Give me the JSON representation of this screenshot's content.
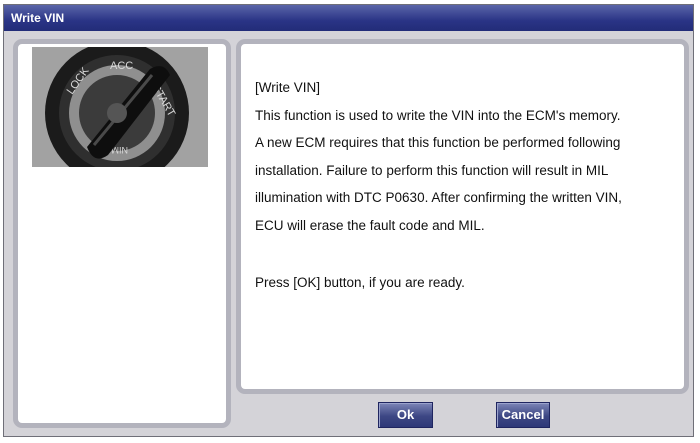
{
  "window": {
    "title": "Write VIN"
  },
  "left_panel": {
    "image": "ignition-key-switch"
  },
  "message": {
    "heading": "[Write VIN]",
    "lines": [
      "This function is used to write the VIN into the ECM's memory.",
      "A new ECM requires that this function be performed following",
      "installation. Failure to perform this function will result in MIL",
      "illumination with DTC P0630. After confirming the written VIN,",
      "ECU will erase the fault code and MIL."
    ],
    "prompt": "Press [OK] button, if you are ready."
  },
  "buttons": {
    "ok_label": "Ok",
    "cancel_label": "Cancel"
  },
  "colors": {
    "titlebar": "#2a3486",
    "window_bg": "#d4d3d8",
    "panel_border": "#b3b3bd",
    "button_bg": "#3d4784"
  }
}
